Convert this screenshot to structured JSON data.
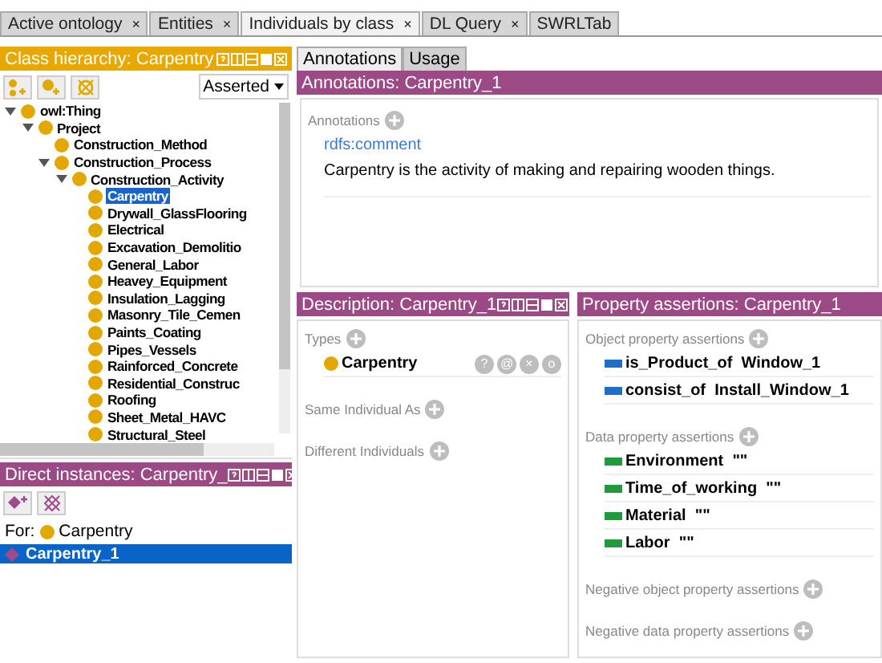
{
  "tabs": [
    {
      "label": "Active ontology",
      "close": "×",
      "selected": false
    },
    {
      "label": "Entities",
      "close": "×",
      "selected": false
    },
    {
      "label": "Individuals by class",
      "close": "×",
      "selected": true
    },
    {
      "label": "DL Query",
      "close": "×",
      "selected": false
    },
    {
      "label": "SWRLTab",
      "selected": false
    }
  ],
  "class_hierarchy": {
    "title": "Class hierarchy: Carpentry",
    "mode": "Asserted",
    "tree": [
      {
        "label": "owl:Thing",
        "selected": false,
        "expanded": true,
        "children": [
          {
            "label": "Project",
            "selected": false,
            "expanded": true,
            "children": [
              {
                "label": "Construction_Method",
                "selected": false
              },
              {
                "label": "Construction_Process",
                "selected": false,
                "expanded": true,
                "children": [
                  {
                    "label": "Construction_Activity",
                    "selected": false,
                    "expanded": true,
                    "children": [
                      {
                        "label": "Carpentry",
                        "selected": true
                      },
                      {
                        "label": "Drywall_GlassFlooring",
                        "selected": false
                      },
                      {
                        "label": "Electrical",
                        "selected": false
                      },
                      {
                        "label": "Excavation_Demolitio",
                        "selected": false
                      },
                      {
                        "label": "General_Labor",
                        "selected": false
                      },
                      {
                        "label": "Heavey_Equipment",
                        "selected": false
                      },
                      {
                        "label": "Insulation_Lagging",
                        "selected": false
                      },
                      {
                        "label": "Masonry_Tile_Cemen",
                        "selected": false
                      },
                      {
                        "label": "Paints_Coating",
                        "selected": false
                      },
                      {
                        "label": "Pipes_Vessels",
                        "selected": false
                      },
                      {
                        "label": "Rainforced_Concrete",
                        "selected": false
                      },
                      {
                        "label": "Residential_Construc",
                        "selected": false
                      },
                      {
                        "label": "Roofing",
                        "selected": false
                      },
                      {
                        "label": "Sheet_Metal_HAVC",
                        "selected": false
                      },
                      {
                        "label": "Structural_Steel",
                        "selected": false
                      }
                    ]
                  }
                ]
              }
            ]
          }
        ]
      }
    ]
  },
  "direct_instances": {
    "title": "Direct instances: Carpentry_",
    "for_label": "For:",
    "for_class": "Carpentry",
    "items": [
      {
        "label": "Carpentry_1",
        "selected": true
      }
    ]
  },
  "entity_tabs": [
    {
      "label": "Annotations",
      "selected": true
    },
    {
      "label": "Usage",
      "selected": false
    }
  ],
  "annotations": {
    "title": "Annotations: Carpentry_1",
    "section": "Annotations",
    "items": [
      {
        "property": "rdfs:comment",
        "value": "Carpentry is the activity of making and repairing wooden things."
      }
    ]
  },
  "description": {
    "title": "Description: Carpentry_1",
    "sections": [
      {
        "label": "Types",
        "items": [
          {
            "label": "Carpentry",
            "actions": [
              "?",
              "@",
              "×",
              "o"
            ]
          }
        ]
      },
      {
        "label": "Same Individual As"
      },
      {
        "label": "Different Individuals"
      }
    ]
  },
  "property_assertions": {
    "title": "Property assertions: Carpentry_1",
    "sections": [
      {
        "label": "Object property assertions",
        "kind": "object",
        "items": [
          {
            "property": "is_Product_of",
            "value": "Window_1"
          },
          {
            "property": "consist_of",
            "value": "Install_Window_1"
          }
        ]
      },
      {
        "label": "Data property assertions",
        "kind": "data",
        "items": [
          {
            "property": "Environment",
            "value": "\"\""
          },
          {
            "property": "Time_of_working",
            "value": "\"\""
          },
          {
            "property": "Material",
            "value": "\"\""
          },
          {
            "property": "Labor",
            "value": "\"\""
          }
        ]
      },
      {
        "label": "Negative object property assertions",
        "kind": "object"
      },
      {
        "label": "Negative data property assertions",
        "kind": "data"
      }
    ]
  }
}
